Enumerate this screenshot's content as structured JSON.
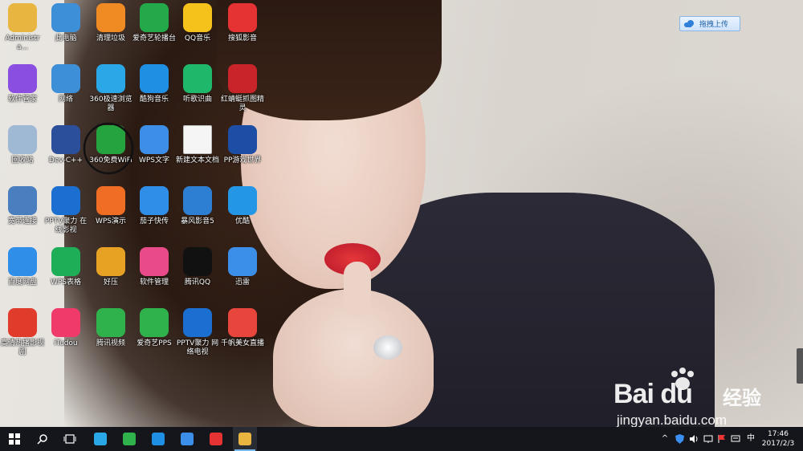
{
  "desktop_icons": [
    {
      "label": "Administra...",
      "icon": "folder-user-icon",
      "color": "#e8b640"
    },
    {
      "label": "此电脑",
      "icon": "computer-icon",
      "color": "#3d8fd8"
    },
    {
      "label": "清理垃圾",
      "icon": "broom-icon",
      "color": "#f08a22"
    },
    {
      "label": "爱奇艺轮播台",
      "icon": "tv-icon",
      "color": "#23a84a"
    },
    {
      "label": "QQ音乐",
      "icon": "music-note-icon",
      "color": "#f5c21b"
    },
    {
      "label": "搜狐影音",
      "icon": "play-icon",
      "color": "#e53232"
    },
    {
      "label": "软件管家",
      "icon": "app-store-icon",
      "color": "#8a4fe0"
    },
    {
      "label": "网络",
      "icon": "network-icon",
      "color": "#3d8fd8"
    },
    {
      "label": "360极速浏览器",
      "icon": "browser-360-icon",
      "color": "#2aa7e6"
    },
    {
      "label": "酷狗音乐",
      "icon": "kugou-icon",
      "color": "#1f8fe3"
    },
    {
      "label": "听歌识曲",
      "icon": "recognize-music-icon",
      "color": "#1fb86a"
    },
    {
      "label": "红蜻蜓抓图精灵",
      "icon": "dragonfly-icon",
      "color": "#c8242a"
    },
    {
      "label": "回收站",
      "icon": "recycle-bin-icon",
      "color": "#9fb8d4"
    },
    {
      "label": "Dev-C++",
      "icon": "dev-cpp-icon",
      "color": "#2c4f9c"
    },
    {
      "label": "360免费WiFi",
      "icon": "wifi-icon",
      "color": "#25a33f"
    },
    {
      "label": "WPS文字",
      "icon": "wps-writer-icon",
      "color": "#3d8ee6"
    },
    {
      "label": "新建文本文档",
      "icon": "text-file-icon",
      "color": "#f5f5f5"
    },
    {
      "label": "PP游戏世界",
      "icon": "game-icon",
      "color": "#1c4ea6"
    },
    {
      "label": "宽带连接",
      "icon": "broadband-icon",
      "color": "#4a7fbf"
    },
    {
      "label": "PPTV聚力 在线影视",
      "icon": "pptv-icon",
      "color": "#1a6fd1"
    },
    {
      "label": "WPS演示",
      "icon": "wps-presentation-icon",
      "color": "#f06d24"
    },
    {
      "label": "茄子快传",
      "icon": "transfer-icon",
      "color": "#2f8fe8"
    },
    {
      "label": "暴风影音5",
      "icon": "film-icon",
      "color": "#2d7fd3"
    },
    {
      "label": "优酷",
      "icon": "youku-icon",
      "color": "#2496e6"
    },
    {
      "label": "百度网盘",
      "icon": "baidu-cloud-icon",
      "color": "#2f8fe8"
    },
    {
      "label": "WPS表格",
      "icon": "wps-spreadsheet-icon",
      "color": "#1fae58"
    },
    {
      "label": "好压",
      "icon": "archive-icon",
      "color": "#e7a224"
    },
    {
      "label": "软件管理",
      "icon": "pinwheel-icon",
      "color": "#e84a8a"
    },
    {
      "label": "腾讯QQ",
      "icon": "qq-penguin-icon",
      "color": "#111111"
    },
    {
      "label": "迅雷",
      "icon": "thunder-icon",
      "color": "#3c8fe8"
    },
    {
      "label": "高清热播影视剧",
      "icon": "sohu-video-icon",
      "color": "#e03b2b"
    },
    {
      "label": "iTudou",
      "icon": "tudou-icon",
      "color": "#ef3a6a"
    },
    {
      "label": "腾讯视频",
      "icon": "tencent-video-icon",
      "color": "#2fb24b"
    },
    {
      "label": "爱奇艺PPS",
      "icon": "iqiyi-icon",
      "color": "#2fb24b"
    },
    {
      "label": "PPTV聚力 网络电视",
      "icon": "pptv-tv-icon",
      "color": "#1a6fd1"
    },
    {
      "label": "千帆美女直播",
      "icon": "live-icon",
      "color": "#e8463d"
    }
  ],
  "upload_button": {
    "label": "拖拽上传",
    "icon": "cloud-icon"
  },
  "watermark": {
    "logo": "Bai du",
    "cn": "经验",
    "url": "jingyan.baidu.com"
  },
  "taskbar": {
    "start_icon": "windows-start-icon",
    "search_icon": "search-icon",
    "task_view_icon": "task-view-icon",
    "pinned": [
      {
        "icon": "browser-360-icon",
        "color": "#2aa7e6"
      },
      {
        "icon": "iqiyi-icon",
        "color": "#2fb24b"
      },
      {
        "icon": "kugou-icon",
        "color": "#1f8fe3"
      },
      {
        "icon": "thunder-icon",
        "color": "#3c8fe8"
      },
      {
        "icon": "sohu-player-icon",
        "color": "#e53232"
      },
      {
        "icon": "file-explorer-icon",
        "color": "#e8b640"
      }
    ],
    "tray": {
      "ime": "中",
      "time": "17:46",
      "date": "2017/2/3"
    }
  }
}
